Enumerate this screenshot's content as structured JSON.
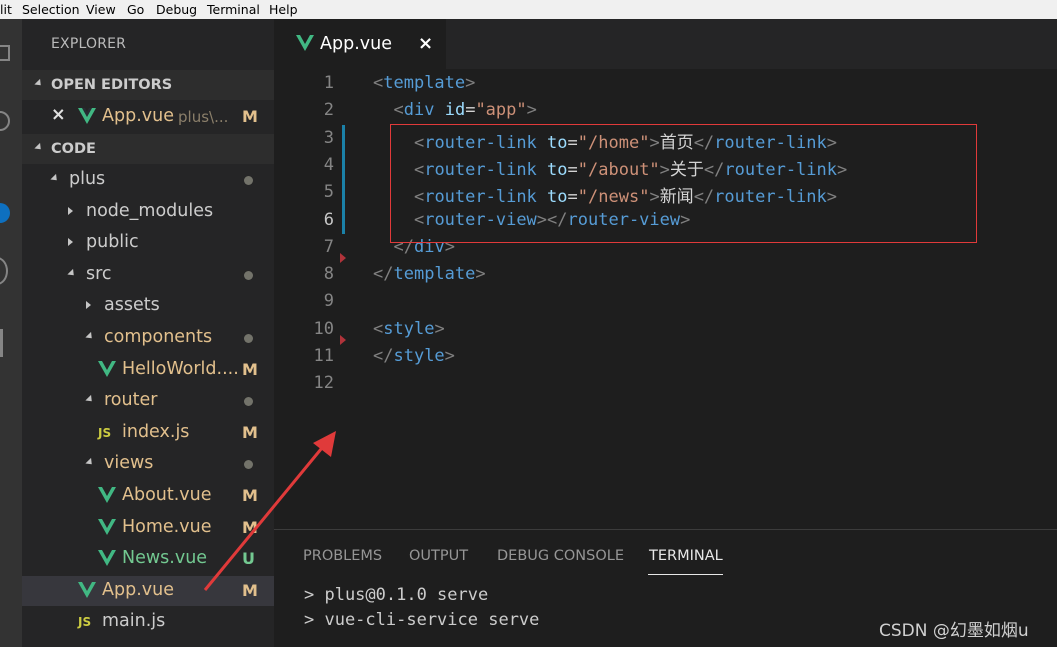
{
  "menubar": [
    "lit",
    "Selection",
    "View",
    "Go",
    "Debug",
    "Terminal",
    "Help"
  ],
  "explorer": {
    "title": "EXPLORER",
    "open_editors_label": "OPEN EDITORS",
    "open_editor": {
      "close": "×",
      "name": "App.vue",
      "path": "plus\\...",
      "badge": "M"
    },
    "project_label": "CODE",
    "tree": [
      {
        "label": "plus",
        "status": "dot",
        "color": "#cccccc"
      },
      {
        "label": "node_modules",
        "status": "",
        "color": "#cccccc"
      },
      {
        "label": "public",
        "status": "",
        "color": "#cccccc"
      },
      {
        "label": "src",
        "status": "dot",
        "color": "#cccccc"
      },
      {
        "label": "assets",
        "status": "",
        "color": "#cccccc"
      },
      {
        "label": "components",
        "status": "dot",
        "color": "#e2c08d"
      },
      {
        "label": "HelloWorld....",
        "status": "M",
        "color": "#e2c08d",
        "icon": "vue"
      },
      {
        "label": "router",
        "status": "dot",
        "color": "#e2c08d"
      },
      {
        "label": "index.js",
        "status": "M",
        "color": "#e2c08d",
        "icon": "js"
      },
      {
        "label": "views",
        "status": "dot",
        "color": "#e2c08d"
      },
      {
        "label": "About.vue",
        "status": "M",
        "color": "#e2c08d",
        "icon": "vue"
      },
      {
        "label": "Home.vue",
        "status": "M",
        "color": "#e2c08d",
        "icon": "vue"
      },
      {
        "label": "News.vue",
        "status": "U",
        "color": "#73c991",
        "icon": "vue"
      },
      {
        "label": "App.vue",
        "status": "M",
        "color": "#e2c08d",
        "icon": "vue"
      },
      {
        "label": "main.js",
        "status": "",
        "color": "#cccccc",
        "icon": "js"
      }
    ]
  },
  "tab": {
    "name": "App.vue",
    "close": "×"
  },
  "editor": {
    "line_numbers": [
      "1",
      "2",
      "3",
      "4",
      "5",
      "6",
      "7",
      "8",
      "9",
      "10",
      "11",
      "12"
    ],
    "current_line": "6",
    "lines": [
      {
        "indent": "",
        "tokens": [
          [
            "p",
            "<"
          ],
          [
            "t",
            "template"
          ],
          [
            "p",
            ">"
          ]
        ]
      },
      {
        "indent": "  ",
        "tokens": [
          [
            "p",
            "<"
          ],
          [
            "t",
            "div"
          ],
          [
            "w",
            " "
          ],
          [
            "a",
            "id"
          ],
          [
            "w",
            "="
          ],
          [
            "s",
            "\"app\""
          ],
          [
            "p",
            ">"
          ]
        ]
      },
      {
        "indent": "    ",
        "tokens": [
          [
            "p",
            "<"
          ],
          [
            "t",
            "router-link"
          ],
          [
            "w",
            " "
          ],
          [
            "a",
            "to"
          ],
          [
            "w",
            "="
          ],
          [
            "s",
            "\"/home\""
          ],
          [
            "p",
            ">"
          ],
          [
            "w",
            "首页"
          ],
          [
            "p",
            "</"
          ],
          [
            "t",
            "router-link"
          ],
          [
            "p",
            ">"
          ]
        ]
      },
      {
        "indent": "    ",
        "tokens": [
          [
            "p",
            "<"
          ],
          [
            "t",
            "router-link"
          ],
          [
            "w",
            " "
          ],
          [
            "a",
            "to"
          ],
          [
            "w",
            "="
          ],
          [
            "s",
            "\"/about\""
          ],
          [
            "p",
            ">"
          ],
          [
            "w",
            "关于"
          ],
          [
            "p",
            "</"
          ],
          [
            "t",
            "router-link"
          ],
          [
            "p",
            ">"
          ]
        ]
      },
      {
        "indent": "    ",
        "tokens": [
          [
            "p",
            "<"
          ],
          [
            "t",
            "router-link"
          ],
          [
            "w",
            " "
          ],
          [
            "a",
            "to"
          ],
          [
            "w",
            "="
          ],
          [
            "s",
            "\"/news\""
          ],
          [
            "p",
            ">"
          ],
          [
            "w",
            "新闻"
          ],
          [
            "p",
            "</"
          ],
          [
            "t",
            "router-link"
          ],
          [
            "p",
            ">"
          ]
        ]
      },
      {
        "indent": "    ",
        "tokens": [
          [
            "p",
            "<"
          ],
          [
            "t",
            "router-view"
          ],
          [
            "p",
            ">"
          ],
          [
            "p",
            "</"
          ],
          [
            "t",
            "router-view"
          ],
          [
            "p",
            ">"
          ]
        ]
      },
      {
        "indent": "  ",
        "tokens": [
          [
            "p",
            "</"
          ],
          [
            "t",
            "div"
          ],
          [
            "p",
            ">"
          ]
        ]
      },
      {
        "indent": "",
        "tokens": [
          [
            "p",
            "</"
          ],
          [
            "t",
            "template"
          ],
          [
            "p",
            ">"
          ]
        ]
      },
      {
        "indent": "",
        "tokens": []
      },
      {
        "indent": "",
        "tokens": [
          [
            "p",
            "<"
          ],
          [
            "t",
            "style"
          ],
          [
            "p",
            ">"
          ]
        ]
      },
      {
        "indent": "",
        "tokens": [
          [
            "p",
            "</"
          ],
          [
            "t",
            "style"
          ],
          [
            "p",
            ">"
          ]
        ]
      },
      {
        "indent": "",
        "tokens": []
      }
    ]
  },
  "panel": {
    "tabs": [
      "PROBLEMS",
      "OUTPUT",
      "DEBUG CONSOLE",
      "TERMINAL"
    ],
    "active_tab": "TERMINAL",
    "terminal_lines": [
      "> plus@0.1.0 serve",
      "> vue-cli-service serve"
    ]
  },
  "watermark": "CSDN @幻墨如烟u",
  "colors": {
    "annotation_red": "#e03a3a",
    "vue_green": "#41b883"
  }
}
